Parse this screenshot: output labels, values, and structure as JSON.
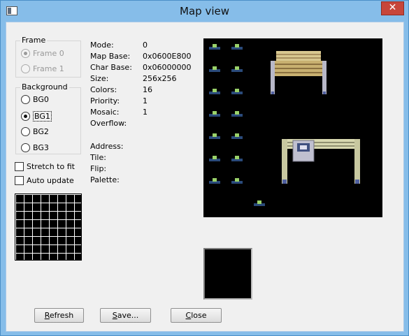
{
  "window": {
    "title": "Map view",
    "close_glyph": "✕"
  },
  "frame": {
    "title": "Frame",
    "options": [
      "Frame 0",
      "Frame 1"
    ],
    "selected": 0,
    "enabled": false
  },
  "background": {
    "title": "Background",
    "options": [
      "BG0",
      "BG1",
      "BG2",
      "BG3"
    ],
    "selected": 1
  },
  "checkboxes": {
    "stretch": "Stretch to fit",
    "auto_update": "Auto update"
  },
  "info": {
    "mode_label": "Mode:",
    "mode_value": "0",
    "map_base_label": "Map Base:",
    "map_base_value": "0x0600E800",
    "char_base_label": "Char Base:",
    "char_base_value": "0x06000000",
    "size_label": "Size:",
    "size_value": "256x256",
    "colors_label": "Colors:",
    "colors_value": "16",
    "priority_label": "Priority:",
    "priority_value": "1",
    "mosaic_label": "Mosaic:",
    "mosaic_value": "1",
    "overflow_label": "Overflow:",
    "address_label": "Address:",
    "tile_label": "Tile:",
    "flip_label": "Flip:",
    "palette_label": "Palette:"
  },
  "buttons": {
    "refresh": {
      "acc": "R",
      "rest": "efresh"
    },
    "save": {
      "acc": "S",
      "rest": "ave..."
    },
    "close": {
      "acc": "C",
      "rest": "lose"
    }
  },
  "icons": {
    "app": "window-app-icon",
    "close": "close-icon"
  }
}
